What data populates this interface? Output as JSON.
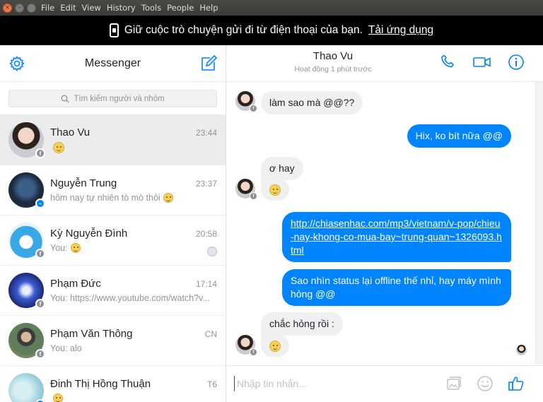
{
  "window": {
    "menu": [
      "File",
      "Edit",
      "View",
      "History",
      "Tools",
      "People",
      "Help"
    ]
  },
  "banner": {
    "text": "Giữ cuộc trò chuyện gửi đi từ điện thoại của bạn.",
    "link": "Tải ứng dụng"
  },
  "sidebar": {
    "title": "Messenger",
    "search_placeholder": "Tìm kiếm người và nhóm",
    "conversations": [
      {
        "name": "Thao Vu",
        "time": "23:44",
        "preview": "",
        "preview_emoji": "smile",
        "badge": "facebook",
        "active": true
      },
      {
        "name": "Nguyễn Trung",
        "time": "23:37",
        "preview": "hôm nay tự nhiên tò mò thôi",
        "preview_emoji": "grin",
        "badge": "messenger"
      },
      {
        "name": "Kỳ Nguyễn Đình",
        "time": "20:58",
        "preview": "You:",
        "preview_emoji": "wink",
        "badge": "facebook"
      },
      {
        "name": "Phạm Đức",
        "time": "17:14",
        "preview": "You: https://www.youtube.com/watch?v...",
        "badge": "facebook"
      },
      {
        "name": "Phạm Văn Thông",
        "time": "CN",
        "preview": "You: alo",
        "badge": "facebook"
      },
      {
        "name": "Đinh Thị Hồng Thuận",
        "time": "T6",
        "preview": "",
        "preview_emoji": "grin",
        "badge": "messenger"
      }
    ]
  },
  "chat": {
    "name": "Thao Vu",
    "status": "Hoạt động 1 phút trước",
    "messages": [
      {
        "dir": "in",
        "text": "làm sao mà @@??"
      },
      {
        "dir": "out",
        "text": "Hix, ko bít nữa @@"
      },
      {
        "dir": "in",
        "text": "ơ hay"
      },
      {
        "dir": "in",
        "emoji": "grin"
      },
      {
        "dir": "out",
        "link": "http://chiasenhac.com/mp3/vietnam/v-pop/chieu-nay-khong-co-mua-bay~trung-quan~1326093.html"
      },
      {
        "dir": "out",
        "text": "Sao nhìn status lại offline thế nhỉ, hay máy mình hỏng @@"
      },
      {
        "dir": "in",
        "text": "chắc hỏng rồi :"
      },
      {
        "dir": "in",
        "emoji": "smile"
      }
    ],
    "composer_placeholder": "Nhập tin nhắn..."
  },
  "colors": {
    "accent": "#0084ff",
    "banner_bg": "#000000",
    "incoming_bubble": "#f1f0f0",
    "menubar": "#3c3b37"
  }
}
